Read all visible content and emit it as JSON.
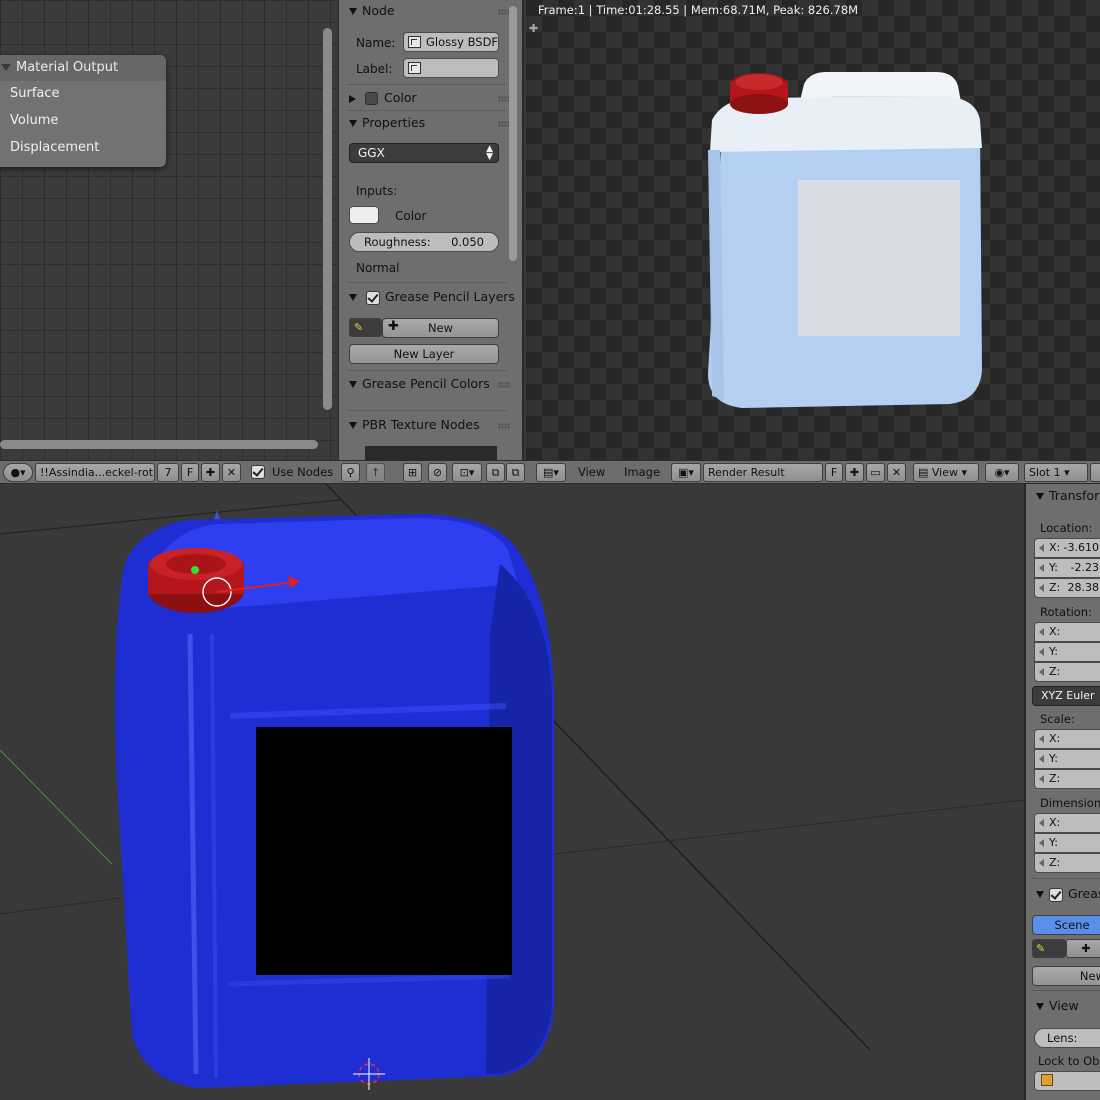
{
  "node_editor": {
    "node_title": "Material Output",
    "sockets": [
      "Surface",
      "Volume",
      "Displacement"
    ]
  },
  "node_panel": {
    "node_header": "Node",
    "name_label": "Name:",
    "name_value": "Glossy BSDF",
    "label_label": "Label:",
    "label_value": "",
    "color_header": "Color",
    "properties_header": "Properties",
    "distribution": "GGX",
    "inputs_label": "Inputs:",
    "color_input": "Color",
    "roughness_label": "Roughness:",
    "roughness_value": "0.050",
    "normal_label": "Normal",
    "gp_layers_header": "Grease Pencil Layers",
    "new_button": "New",
    "new_layer_button": "New Layer",
    "gp_colors_header": "Grease Pencil Colors",
    "pbr_header": "PBR Texture Nodes"
  },
  "render_view": {
    "info": "Frame:1 | Time:01:28.55 | Mem:68.71M, Peak: 826.78M"
  },
  "header": {
    "material_name": "!!Assindia...eckel-rot",
    "users": "7",
    "fake_user": "F",
    "use_nodes": "Use Nodes",
    "view_menu": "View",
    "image_menu": "Image",
    "image_name": "Render Result",
    "image_fake": "F",
    "view_mode": "View",
    "slot": "Slot 1"
  },
  "n_panel": {
    "transform_header": "Transform",
    "location_label": "Location:",
    "loc_x": "-3.610",
    "loc_y": "-2.23",
    "loc_z": "28.38",
    "rotation_label": "Rotation:",
    "rotation_mode": "XYZ Euler",
    "scale_label": "Scale:",
    "dimensions_label": "Dimensions:",
    "grease_header": "Grease",
    "scene_button": "Scene",
    "new_button": "New",
    "view_header": "View",
    "lens_label": "Lens:",
    "lock_label": "Lock to Obje",
    "axis_x": "X:",
    "axis_y": "Y:",
    "axis_z": "Z:"
  },
  "colors": {
    "canister_blue": "#1f2fd6",
    "cap_red": "#b4161c",
    "render_liquid": "#b7d3f3",
    "panel_grey": "#6e6e6e",
    "scene_button": "#5a8ee8"
  }
}
